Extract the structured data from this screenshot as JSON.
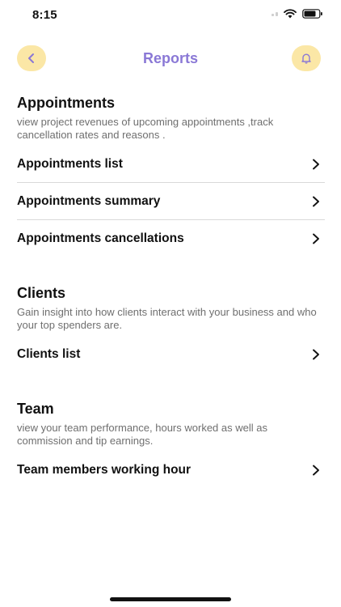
{
  "status_bar": {
    "time": "8:15",
    "icons": [
      "cellular-signal-icon",
      "wifi-icon",
      "battery-icon"
    ]
  },
  "header": {
    "title": "Reports",
    "back_icon": "chevron-left-icon",
    "bell_icon": "bell-icon",
    "accent_color": "#fbe7a6",
    "title_color": "#8a78d6"
  },
  "sections": [
    {
      "title": "Appointments",
      "description": "view project revenues of upcoming appointments ,track cancellation rates and reasons .",
      "items": [
        {
          "label": "Appointments list"
        },
        {
          "label": "Appointments summary"
        },
        {
          "label": "Appointments cancellations"
        }
      ]
    },
    {
      "title": "Clients",
      "description": "Gain insight into how clients interact with your business and who your top spenders are.",
      "items": [
        {
          "label": "Clients list"
        }
      ]
    },
    {
      "title": "Team",
      "description": "view your team performance, hours worked as well as commission and tip earnings.",
      "items": [
        {
          "label": "Team members working hour"
        }
      ]
    }
  ]
}
